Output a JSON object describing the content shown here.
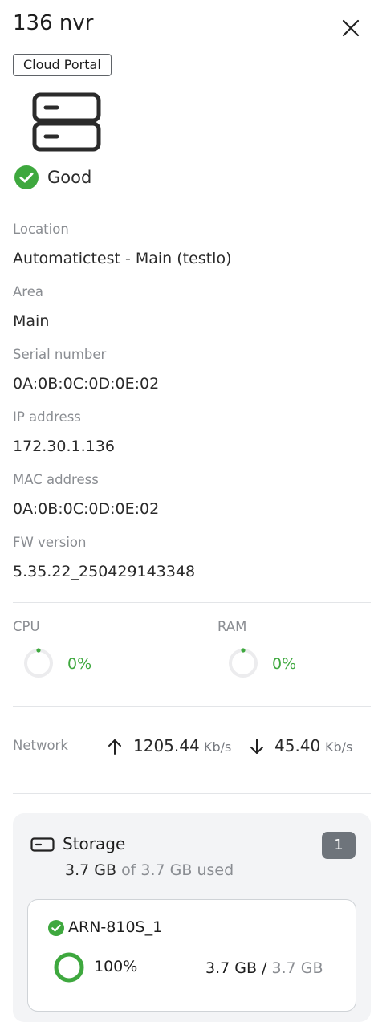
{
  "header": {
    "title": "136 nvr",
    "portal_tag": "Cloud Portal"
  },
  "status": {
    "text": "Good",
    "color": "#3ea83e"
  },
  "details": [
    {
      "label": "Location",
      "value": "Automatictest - Main (testlo)"
    },
    {
      "label": "Area",
      "value": "Main"
    },
    {
      "label": "Serial number",
      "value": "0A:0B:0C:0D:0E:02"
    },
    {
      "label": "IP address",
      "value": "172.30.1.136"
    },
    {
      "label": "MAC address",
      "value": "0A:0B:0C:0D:0E:02"
    },
    {
      "label": "FW version",
      "value": "5.35.22_250429143348"
    }
  ],
  "metrics": {
    "cpu": {
      "label": "CPU",
      "value": "0%",
      "fraction": 0
    },
    "ram": {
      "label": "RAM",
      "value": "0%",
      "fraction": 0
    }
  },
  "network": {
    "label": "Network",
    "upload_value": "1205.44",
    "upload_unit": "Kb/s",
    "download_value": "45.40",
    "download_unit": "Kb/s"
  },
  "storage": {
    "title": "Storage",
    "count": "1",
    "used": "3.7 GB",
    "of_text": "of 3.7 GB used",
    "volume": {
      "name": "ARN-810S_1",
      "percent": "100%",
      "fraction": 1,
      "used": "3.7 GB /",
      "total": "3.7 GB"
    }
  },
  "icons": {
    "close": "close-icon",
    "device": "server-icon",
    "status": "check-circle-icon",
    "upload": "arrow-up-icon",
    "download": "arrow-down-icon",
    "storage": "hard-drive-icon"
  },
  "colors": {
    "accent_green": "#3ea83e",
    "badge": "#6e747b",
    "card_bg": "#f3f4f6"
  }
}
